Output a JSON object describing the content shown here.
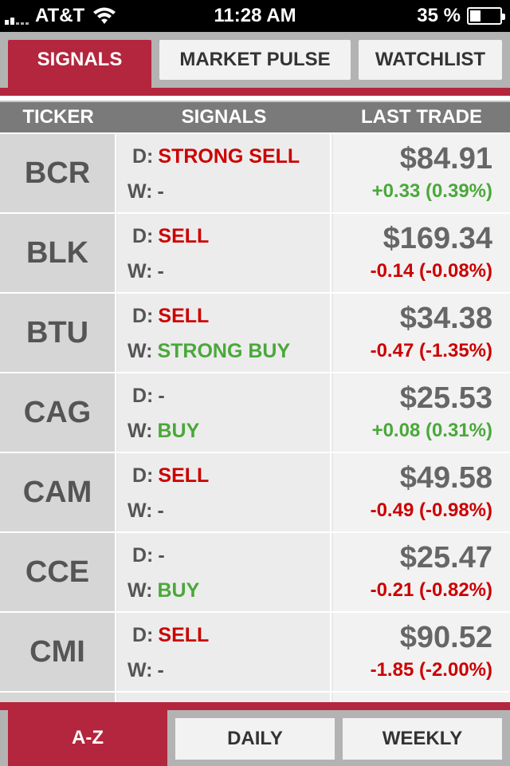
{
  "status_bar": {
    "carrier": "AT&T",
    "time": "11:28 AM",
    "battery": "35 %",
    "battery_level": 0.35
  },
  "top_tabs": {
    "signals": "SIGNALS",
    "market_pulse": "MARKET PULSE",
    "watchlist": "WATCHLIST"
  },
  "columns": {
    "ticker": "TICKER",
    "signals": "SIGNALS",
    "last_trade": "LAST TRADE"
  },
  "labels": {
    "daily": "D:",
    "weekly": "W:"
  },
  "rows": [
    {
      "ticker": "BCR",
      "daily": "STRONG SELL",
      "weekly": "-",
      "price": "$84.91",
      "change": "+0.33 (0.39%)"
    },
    {
      "ticker": "BLK",
      "daily": "SELL",
      "weekly": "-",
      "price": "$169.34",
      "change": "-0.14 (-0.08%)"
    },
    {
      "ticker": "BTU",
      "daily": "SELL",
      "weekly": "STRONG BUY",
      "price": "$34.38",
      "change": "-0.47 (-1.35%)"
    },
    {
      "ticker": "CAG",
      "daily": "-",
      "weekly": "BUY",
      "price": "$25.53",
      "change": "+0.08 (0.31%)"
    },
    {
      "ticker": "CAM",
      "daily": "SELL",
      "weekly": "-",
      "price": "$49.58",
      "change": "-0.49 (-0.98%)"
    },
    {
      "ticker": "CCE",
      "daily": "-",
      "weekly": "BUY",
      "price": "$25.47",
      "change": "-0.21 (-0.82%)"
    },
    {
      "ticker": "CMI",
      "daily": "SELL",
      "weekly": "-",
      "price": "$90.52",
      "change": "-1.85 (-2.00%)"
    }
  ],
  "bottom_tabs": {
    "az": "A-Z",
    "daily": "DAILY",
    "weekly": "WEEKLY"
  },
  "colors": {
    "accent": "#b3263d",
    "sell": "#cc0000",
    "buy": "#4aa83a",
    "neutral": "#555555"
  }
}
